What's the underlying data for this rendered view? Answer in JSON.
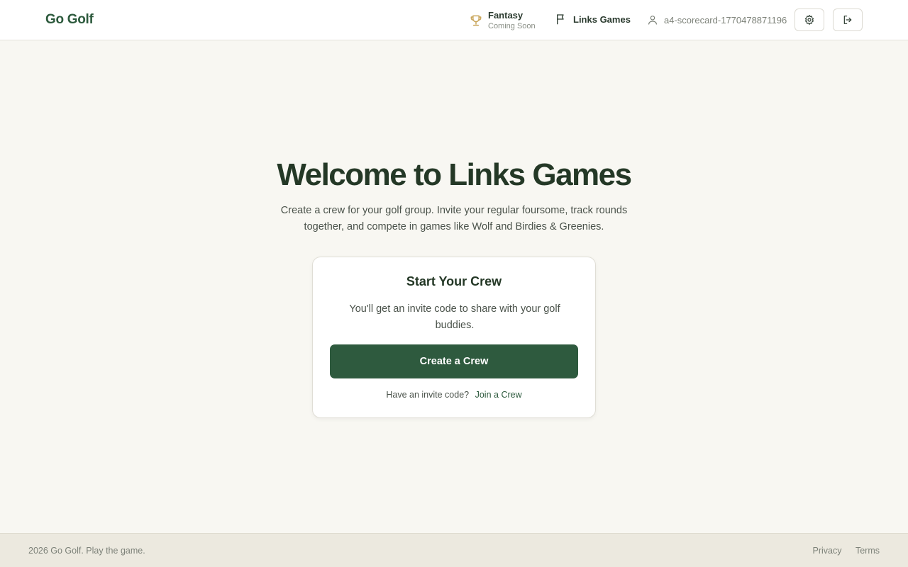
{
  "header": {
    "brand": "Go Golf",
    "nav": {
      "fantasy": {
        "label": "Fantasy",
        "sub": "Coming Soon",
        "icon": "trophy-icon"
      },
      "links_games": {
        "label": "Links Games",
        "icon": "flag-icon"
      }
    },
    "user": {
      "name": "a4-scorecard-1770478871196",
      "icon": "user-icon"
    },
    "buttons": {
      "settings_icon": "gear-icon",
      "logout_icon": "logout-icon"
    }
  },
  "hero": {
    "title": "Welcome to Links Games",
    "subtitle": "Create a crew for your golf group. Invite your regular foursome, track rounds together, and compete in games like Wolf and Birdies & Greenies."
  },
  "card": {
    "title": "Start Your Crew",
    "description": "You'll get an invite code to share with your golf buddies.",
    "create_label": "Create a Crew",
    "invite_prompt": "Have an invite code?",
    "join_label": "Join a Crew"
  },
  "footer": {
    "copyright": "2026 Go Golf. Play the game.",
    "privacy": "Privacy",
    "terms": "Terms"
  },
  "colors": {
    "brand": "#2d5a3d",
    "button": "#2e5a3e",
    "trophy": "#c9a55a",
    "background": "#f8f7f2"
  }
}
